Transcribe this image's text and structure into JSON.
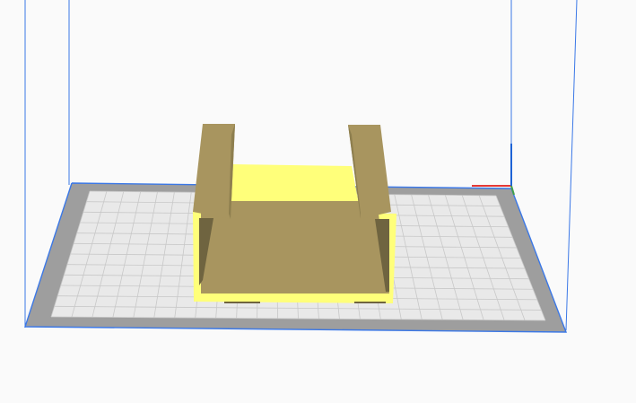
{
  "viewport": {
    "background": "#fafafa",
    "build_volume_edge_color": "#3b78e7",
    "plate_outer_color": "#9e9e9e",
    "plate_inner_color": "#e9e9e9",
    "plate_grid_color": "#c8c8c8"
  },
  "model": {
    "face_top_color": "#a8955f",
    "face_dark_color": "#6f6440",
    "face_side_color": "#8e7f4f",
    "highlight_color": "#ffff7a"
  },
  "axis_indicator": {
    "x_color": "#e53935",
    "y_color": "#43a047",
    "z_color": "#1e63d6"
  }
}
